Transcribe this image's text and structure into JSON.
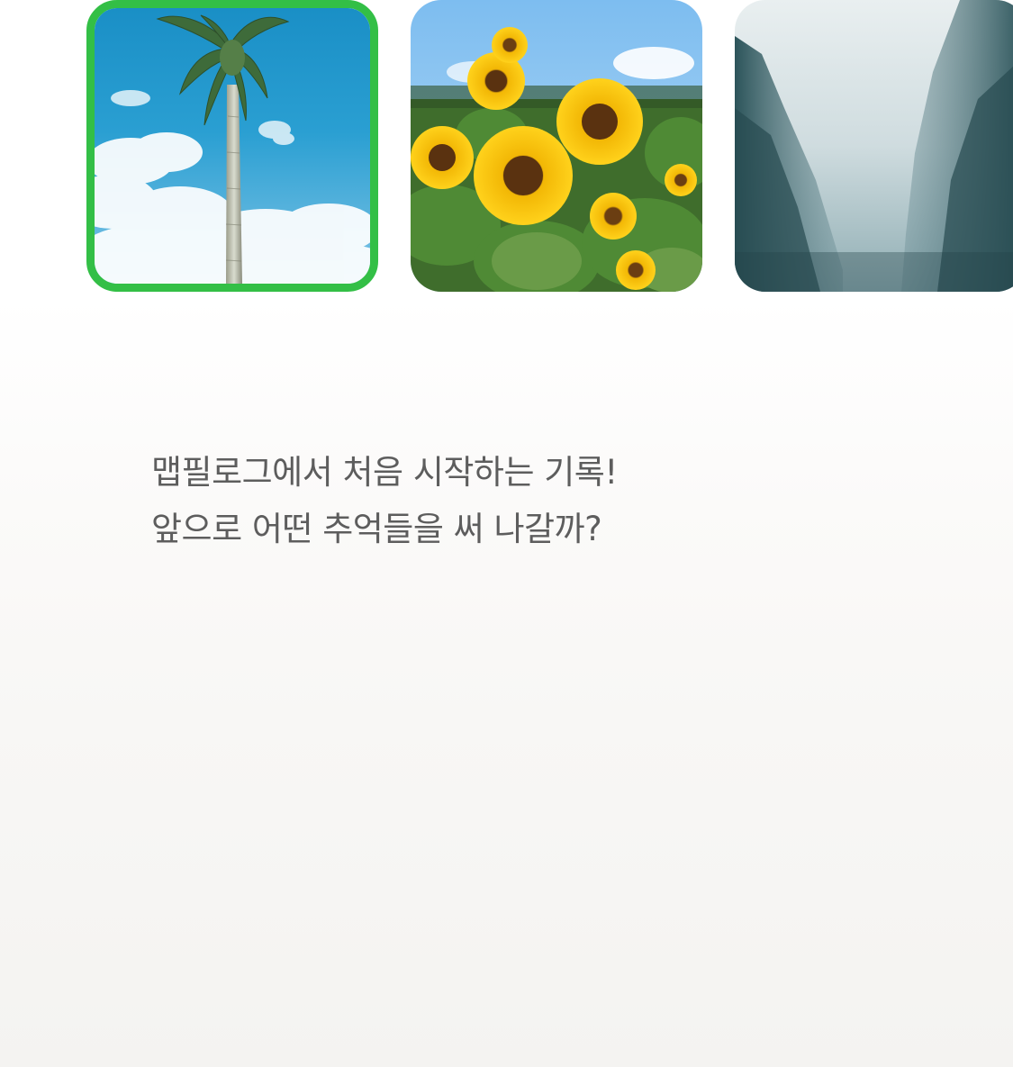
{
  "photos": [
    {
      "subject": "palm-tree",
      "selected": true
    },
    {
      "subject": "sunflowers",
      "selected": false
    },
    {
      "subject": "misty-forest",
      "selected": false
    }
  ],
  "colors": {
    "selection_border": "#33bf46",
    "message_text": "#5d5d5d",
    "background_top": "#ffffff",
    "background_bottom": "#f4f3f1"
  },
  "intro": {
    "line1": "맵필로그에서 처음 시작하는 기록!",
    "line2": "앞으로 어떤 추억들을 써 나갈까?"
  }
}
